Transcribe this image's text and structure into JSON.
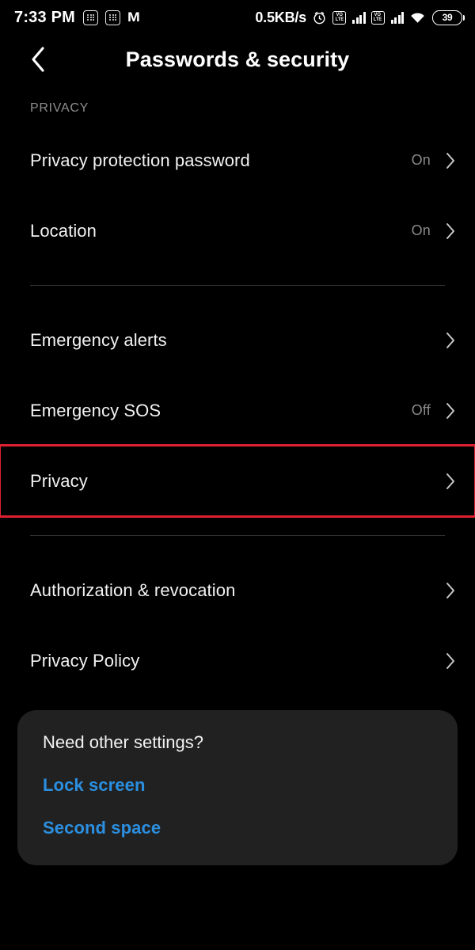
{
  "status_bar": {
    "time": "7:33 PM",
    "left_icons": [
      "app-grid-icon",
      "app-grid-icon",
      "m-logo-icon"
    ],
    "net_speed": "0.5KB/s",
    "right_icons": [
      "alarm-icon",
      "volte-icon",
      "signal-bars-icon",
      "volte-icon",
      "signal-bars-icon",
      "wifi-icon"
    ],
    "volte_line1": "VO",
    "volte_line2": "LTE",
    "battery_level": "39"
  },
  "appbar": {
    "back_icon": "chevron-left-icon",
    "title": "Passwords & security"
  },
  "section": {
    "label": "PRIVACY"
  },
  "rows": [
    {
      "label": "Privacy protection password",
      "value": "On",
      "highlighted": false
    },
    {
      "label": "Location",
      "value": "On",
      "highlighted": false
    },
    {
      "label": "Emergency alerts",
      "value": "",
      "highlighted": false
    },
    {
      "label": "Emergency SOS",
      "value": "Off",
      "highlighted": false
    },
    {
      "label": "Privacy",
      "value": "",
      "highlighted": true
    },
    {
      "label": "Authorization & revocation",
      "value": "",
      "highlighted": false
    },
    {
      "label": "Privacy Policy",
      "value": "",
      "highlighted": false
    }
  ],
  "footer": {
    "title": "Need other settings?",
    "links": [
      {
        "label": "Lock screen"
      },
      {
        "label": "Second space"
      }
    ]
  },
  "colors": {
    "background": "#000000",
    "card": "#212121",
    "link": "#2b8fe0",
    "highlight": "#e02030",
    "muted": "#8a8a8a",
    "divider": "#333333"
  }
}
